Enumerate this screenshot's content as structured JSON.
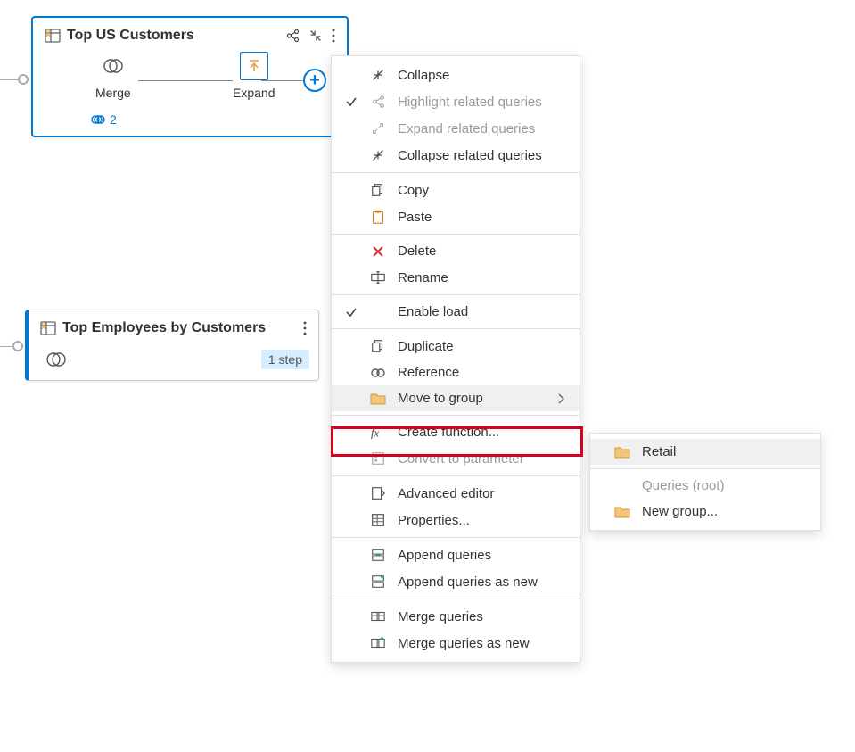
{
  "nodes": {
    "n1": {
      "title": "Top US Customers",
      "steps": {
        "merge": "Merge",
        "expand": "Expand"
      },
      "link_count": "2"
    },
    "n2": {
      "title": "Top Employees by Customers",
      "step_chip": "1 step"
    }
  },
  "context_menu": {
    "collapse": "Collapse",
    "highlight_related": "Highlight related queries",
    "expand_related": "Expand related queries",
    "collapse_related": "Collapse related queries",
    "copy": "Copy",
    "paste": "Paste",
    "delete": "Delete",
    "rename": "Rename",
    "enable_load": "Enable load",
    "duplicate": "Duplicate",
    "reference": "Reference",
    "move_to_group": "Move to group",
    "create_function": "Create function...",
    "convert_to_param": "Convert to parameter",
    "advanced_editor": "Advanced editor",
    "properties": "Properties...",
    "append_queries": "Append queries",
    "append_queries_new": "Append queries as new",
    "merge_queries": "Merge queries",
    "merge_queries_new": "Merge queries as new"
  },
  "submenu": {
    "retail": "Retail",
    "queries_root": "Queries (root)",
    "new_group": "New group..."
  }
}
